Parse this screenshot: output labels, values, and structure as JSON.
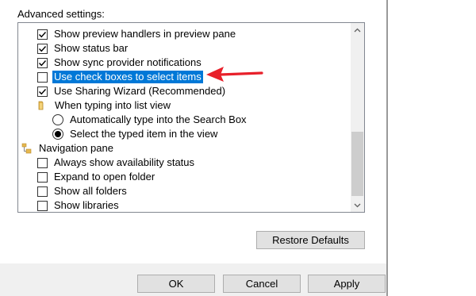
{
  "advanced_settings": {
    "label": "Advanced settings:",
    "items": [
      {
        "type": "checkbox",
        "label": "Show preview handlers in preview pane",
        "checked": true
      },
      {
        "type": "checkbox",
        "label": "Show status bar",
        "checked": true
      },
      {
        "type": "checkbox",
        "label": "Show sync provider notifications",
        "checked": true
      },
      {
        "type": "checkbox",
        "label": "Use check boxes to select items",
        "checked": false,
        "selected": true
      },
      {
        "type": "checkbox",
        "label": "Use Sharing Wizard (Recommended)",
        "checked": true
      },
      {
        "type": "group",
        "label": "When typing into list view",
        "icon": "folder-icon"
      },
      {
        "type": "radio",
        "label": "Automatically type into the Search Box",
        "checked": false
      },
      {
        "type": "radio",
        "label": "Select the typed item in the view",
        "checked": true
      },
      {
        "type": "group",
        "label": "Navigation pane",
        "icon": "navigation-pane-icon"
      },
      {
        "type": "checkbox",
        "label": "Always show availability status",
        "checked": false
      },
      {
        "type": "checkbox",
        "label": "Expand to open folder",
        "checked": false
      },
      {
        "type": "checkbox",
        "label": "Show all folders",
        "checked": false
      },
      {
        "type": "checkbox",
        "label": "Show libraries",
        "checked": false
      }
    ]
  },
  "buttons": {
    "restore_defaults": "Restore Defaults",
    "ok": "OK",
    "cancel": "Cancel",
    "apply": "Apply"
  },
  "colors": {
    "selection": "#0078d7",
    "annotation_arrow": "#e8202a"
  }
}
